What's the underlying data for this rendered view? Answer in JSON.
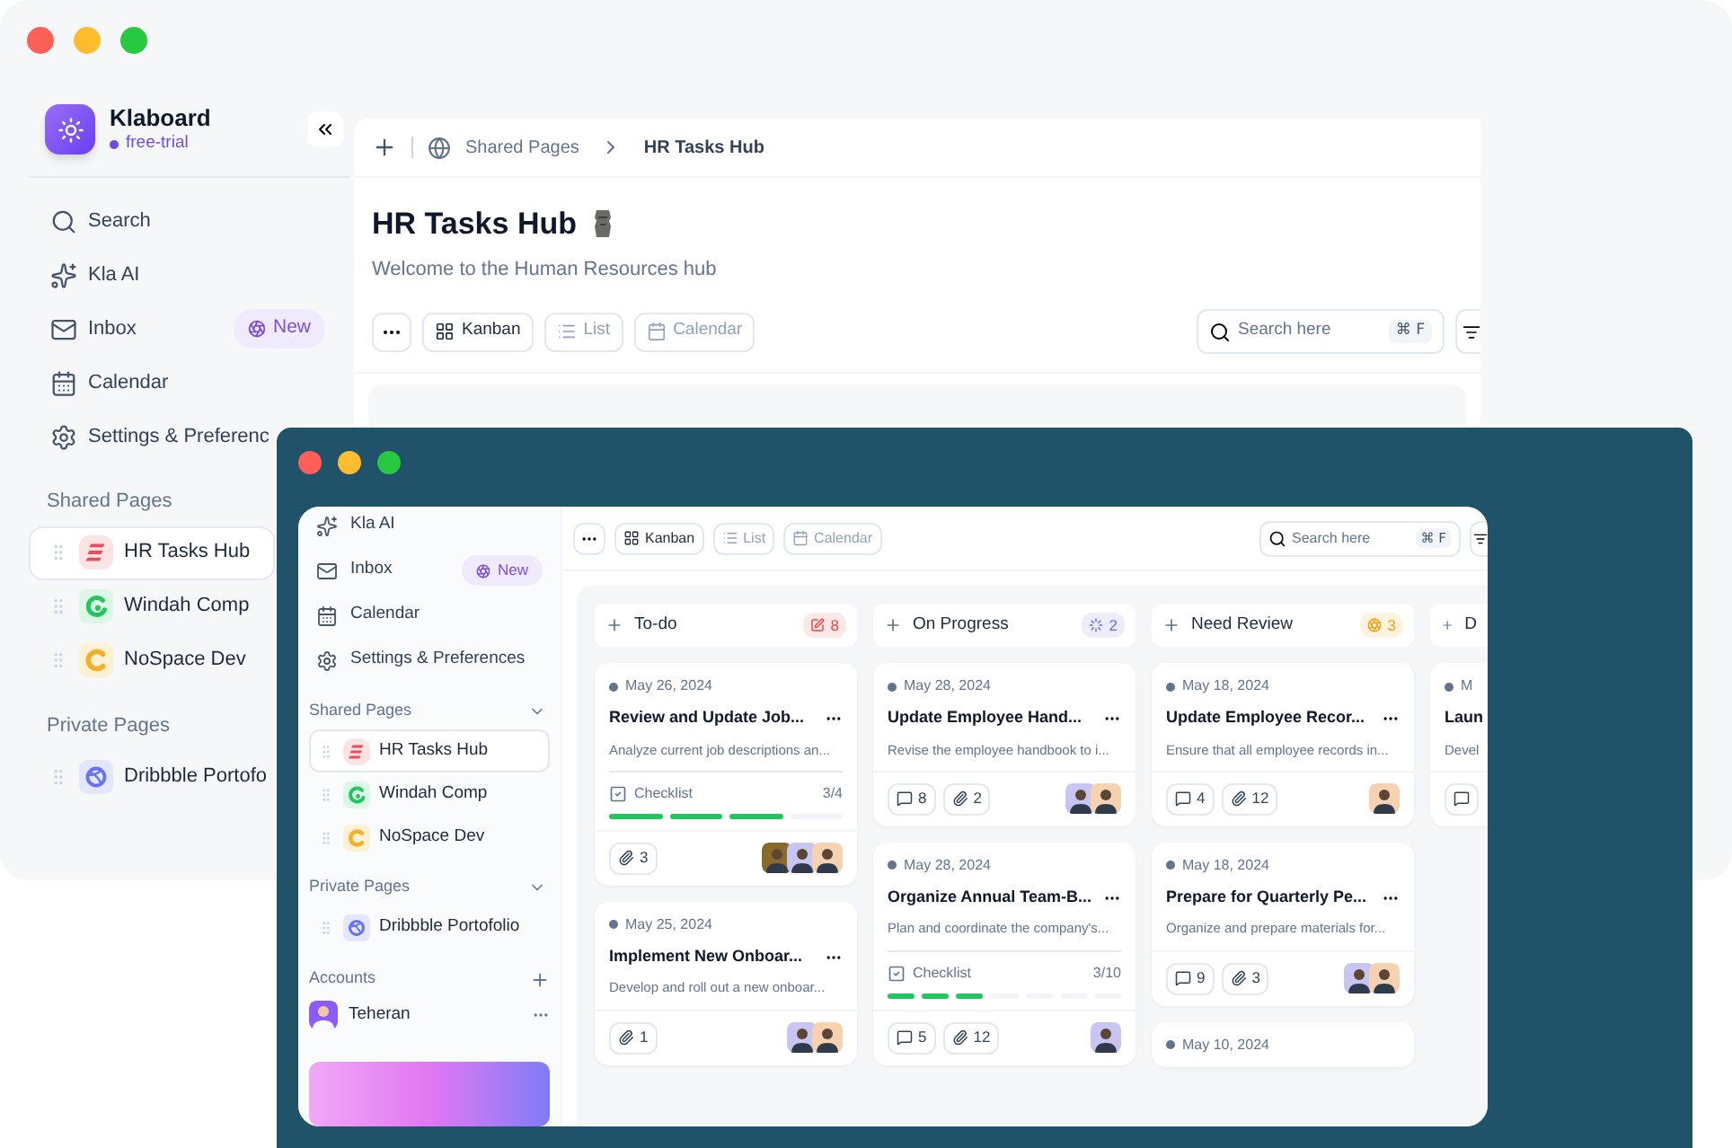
{
  "back_window": {
    "workspace": {
      "name": "Klaboard",
      "plan": "free-trial"
    },
    "nav": [
      {
        "label": "Search",
        "kind": "search"
      },
      {
        "label": "Kla AI",
        "kind": "ai"
      },
      {
        "label": "Inbox",
        "kind": "inbox",
        "badge": "New"
      },
      {
        "label": "Calendar",
        "kind": "calendar"
      },
      {
        "label": "Settings & Preferenc",
        "kind": "settings"
      }
    ],
    "sections": [
      {
        "title": "Shared Pages",
        "pages": [
          {
            "label": "HR Tasks Hub",
            "kind": "hr",
            "selected": true
          },
          {
            "label": "Windah Comp",
            "kind": "windah",
            "selected": false
          },
          {
            "label": "NoSpace Dev",
            "kind": "nospace",
            "selected": false
          }
        ]
      },
      {
        "title": "Private Pages",
        "pages": [
          {
            "label": "Dribbble Portofo",
            "kind": "dribbble",
            "selected": false
          }
        ]
      }
    ],
    "breadcrumb": [
      "Shared Pages",
      "HR Tasks Hub"
    ],
    "page_title": "HR Tasks Hub",
    "page_subtitle": "Welcome to the Human Resources hub",
    "views": [
      {
        "label": "Kanban",
        "kind": "kanban",
        "selected": true
      },
      {
        "label": "List",
        "kind": "list",
        "selected": false
      },
      {
        "label": "Calendar",
        "kind": "calendar",
        "selected": false
      }
    ],
    "search": {
      "placeholder": "Search here",
      "shortcut": "⌘ F"
    }
  },
  "front_window": {
    "nav": [
      {
        "label": "Kla AI",
        "kind": "ai"
      },
      {
        "label": "Inbox",
        "kind": "inbox",
        "badge": "New"
      },
      {
        "label": "Calendar",
        "kind": "calendar"
      },
      {
        "label": "Settings & Preferences",
        "kind": "settings"
      }
    ],
    "sections": [
      {
        "title": "Shared Pages",
        "expanded": true,
        "pages": [
          {
            "label": "HR Tasks Hub",
            "kind": "hr",
            "selected": true
          },
          {
            "label": "Windah Comp",
            "kind": "windah",
            "selected": false
          },
          {
            "label": "NoSpace Dev",
            "kind": "nospace",
            "selected": false
          }
        ]
      },
      {
        "title": "Private Pages",
        "expanded": true,
        "pages": [
          {
            "label": "Dribbble Portofolio",
            "kind": "dribbble",
            "selected": false
          }
        ]
      }
    ],
    "accounts": {
      "title": "Accounts",
      "user": "Teheran"
    },
    "views": [
      {
        "label": "Kanban",
        "kind": "kanban",
        "selected": true
      },
      {
        "label": "List",
        "kind": "list",
        "selected": false
      },
      {
        "label": "Calendar",
        "kind": "calendar",
        "selected": false
      }
    ],
    "search": {
      "placeholder": "Search here",
      "shortcut": "⌘ F"
    },
    "columns": [
      {
        "title": "To-do",
        "kind": "todo",
        "count": "8",
        "color": "#ef4444",
        "cards": [
          {
            "date": "May 26, 2024",
            "title": "Review and Update Job...",
            "description": "Analyze current job descriptions an...",
            "checklist": {
              "label": "Checklist",
              "progress": "3/4",
              "steps": [
                {
                  "done": true
                },
                {
                  "done": true
                },
                {
                  "done": true
                },
                {
                  "done": false
                }
              ]
            },
            "attachments": "3",
            "avatars": [
              {
                "color": "#8a6a2a"
              },
              {
                "color": "#c9c5f2"
              },
              {
                "color": "#f6d2b0"
              }
            ]
          },
          {
            "date": "May 25, 2024",
            "title": "Implement New Onboar...",
            "description": "Develop and roll out a new onboar...",
            "attachments": "1",
            "avatars": [
              {
                "color": "#c9c5f2"
              },
              {
                "color": "#f6d2b0"
              }
            ]
          }
        ]
      },
      {
        "title": "On Progress",
        "kind": "progress",
        "count": "2",
        "color": "#6366f1",
        "cards": [
          {
            "date": "May 28, 2024",
            "title": "Update Employee Hand...",
            "description": "Revise the employee handbook to i...",
            "comments": "8",
            "attachments": "2",
            "avatars": [
              {
                "color": "#c9c5f2"
              },
              {
                "color": "#f6d2b0"
              }
            ]
          },
          {
            "date": "May 28, 2024",
            "title": "Organize Annual Team-B...",
            "description": "Plan and coordinate the company's...",
            "checklist": {
              "label": "Checklist",
              "progress": "3/10",
              "steps": [
                {
                  "done": true
                },
                {
                  "done": true
                },
                {
                  "done": true
                },
                {
                  "done": false
                },
                {
                  "done": false
                },
                {
                  "done": false
                },
                {
                  "done": false
                }
              ]
            },
            "comments": "5",
            "attachments": "12",
            "avatars": [
              {
                "color": "#c9c5f2"
              }
            ]
          }
        ]
      },
      {
        "title": "Need Review",
        "kind": "review",
        "count": "3",
        "color": "#f59e0b",
        "cards": [
          {
            "date": "May 18, 2024",
            "title": "Update Employee Recor...",
            "description": "Ensure that all employee records in...",
            "comments": "4",
            "attachments": "12",
            "avatars": [
              {
                "color": "#f6d2b0"
              }
            ]
          },
          {
            "date": "May 18, 2024",
            "title": "Prepare for Quarterly Pe...",
            "description": "Organize and prepare materials for...",
            "comments": "9",
            "attachments": "3",
            "avatars": [
              {
                "color": "#c9c5f2"
              },
              {
                "color": "#f6d2b0"
              }
            ]
          },
          {
            "date": "May 10, 2024"
          }
        ]
      },
      {
        "title": "D",
        "kind": "partial",
        "cards": [
          {
            "date": "M",
            "title": "Laun",
            "description": "Devel",
            "comment_chip": true
          }
        ]
      }
    ]
  }
}
